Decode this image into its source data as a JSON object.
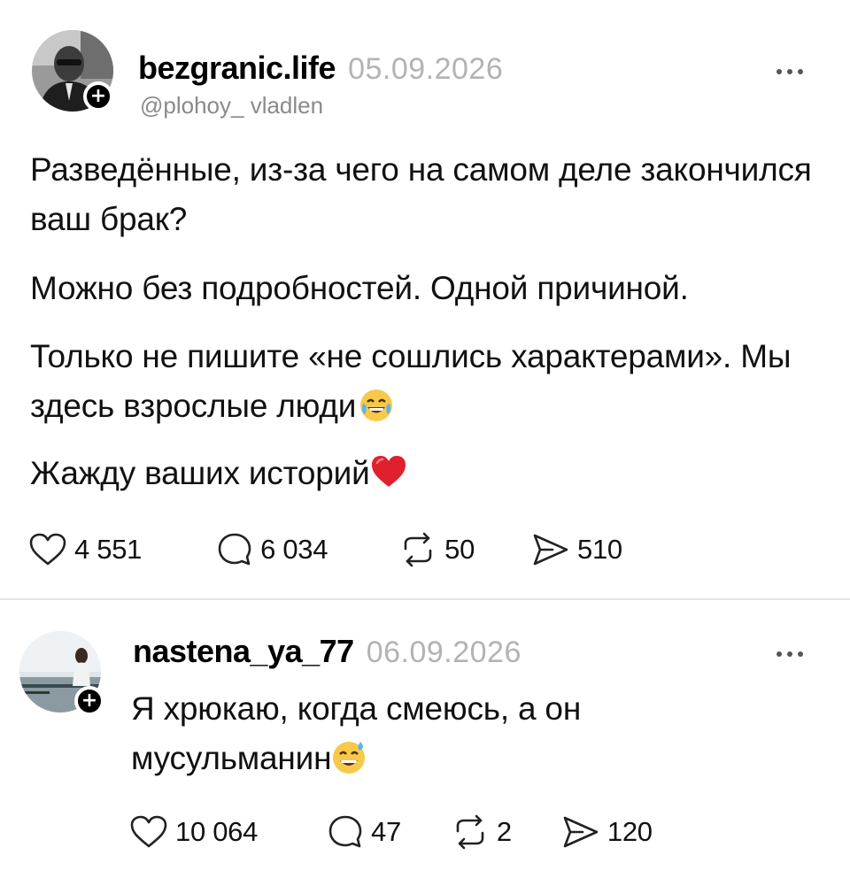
{
  "main_post": {
    "username": "bezgranic.life",
    "timestamp": "05.09.2026",
    "handle": "@plohoy_ vladlen",
    "paragraphs": [
      "Разведённые, из-за чего на самом деле закончился ваш брак?",
      "Можно без подробностей. Одной причиной.",
      "Только не пишите «не сошлись характерами». Мы здесь взрослые люди",
      "Жажду ваших историй"
    ],
    "emoji_laugh": "face-with-tears-of-joy",
    "emoji_heart": "red-heart",
    "actions": {
      "likes": "4 551",
      "comments": "6 034",
      "reposts": "50",
      "shares": "510"
    }
  },
  "reply_post": {
    "username": "nastena_ya_77",
    "timestamp": "06.09.2026",
    "text": "Я хрюкаю, когда смеюсь, а он мусульманин",
    "emoji": "grinning-face-with-sweat",
    "actions": {
      "likes": "10 064",
      "comments": "47",
      "reposts": "2",
      "shares": "120"
    }
  },
  "colors": {
    "text": "#111111",
    "muted": "#8a8a8a",
    "timestamp": "#b3b3b3",
    "divider": "#e4e4e4",
    "heart": "#e0202e"
  }
}
